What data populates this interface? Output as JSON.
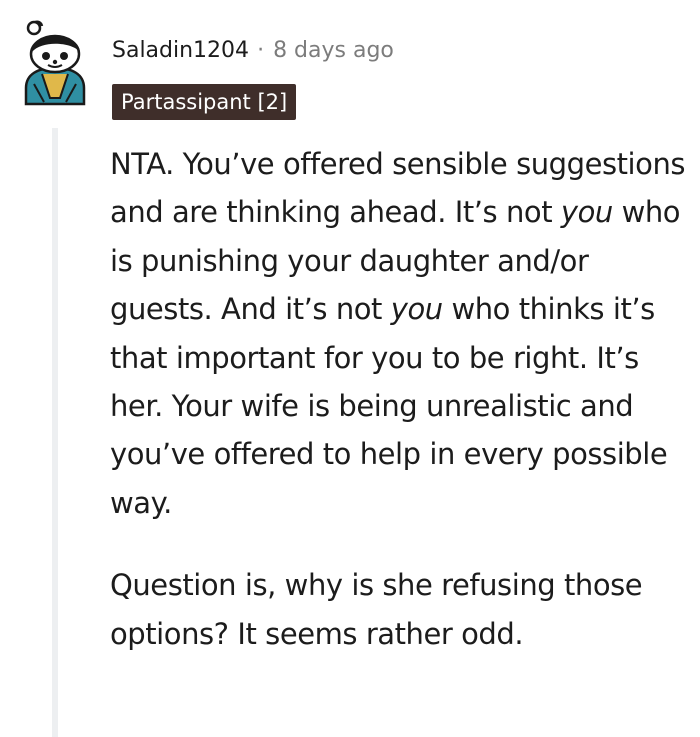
{
  "comment": {
    "username": "Saladin1204",
    "separator": "·",
    "timestamp": "8 days ago",
    "flair": "Partassipant [2]",
    "avatar_icon": "snoo-avatar-icon",
    "paragraphs": [
      {
        "parts": [
          "NTA. You’ve offered sensible suggestions and are thinking ahead. It’s not ",
          "you",
          " who is punishing your daughter and/or guests. And it’s not ",
          "you",
          " who thinks it’s that important for you to be right. It’s her. Your wife is being unrealistic and you’ve offered to help in every possible way."
        ]
      },
      {
        "parts": [
          "Question is, why is she refusing those options? It seems rather odd."
        ]
      }
    ]
  },
  "colors": {
    "flair_background": "#3f2e2a",
    "flair_text": "#ffffff",
    "meta_text": "#7c7c7c",
    "body_text": "#1c1c1c",
    "thread_line": "#edeff1"
  }
}
